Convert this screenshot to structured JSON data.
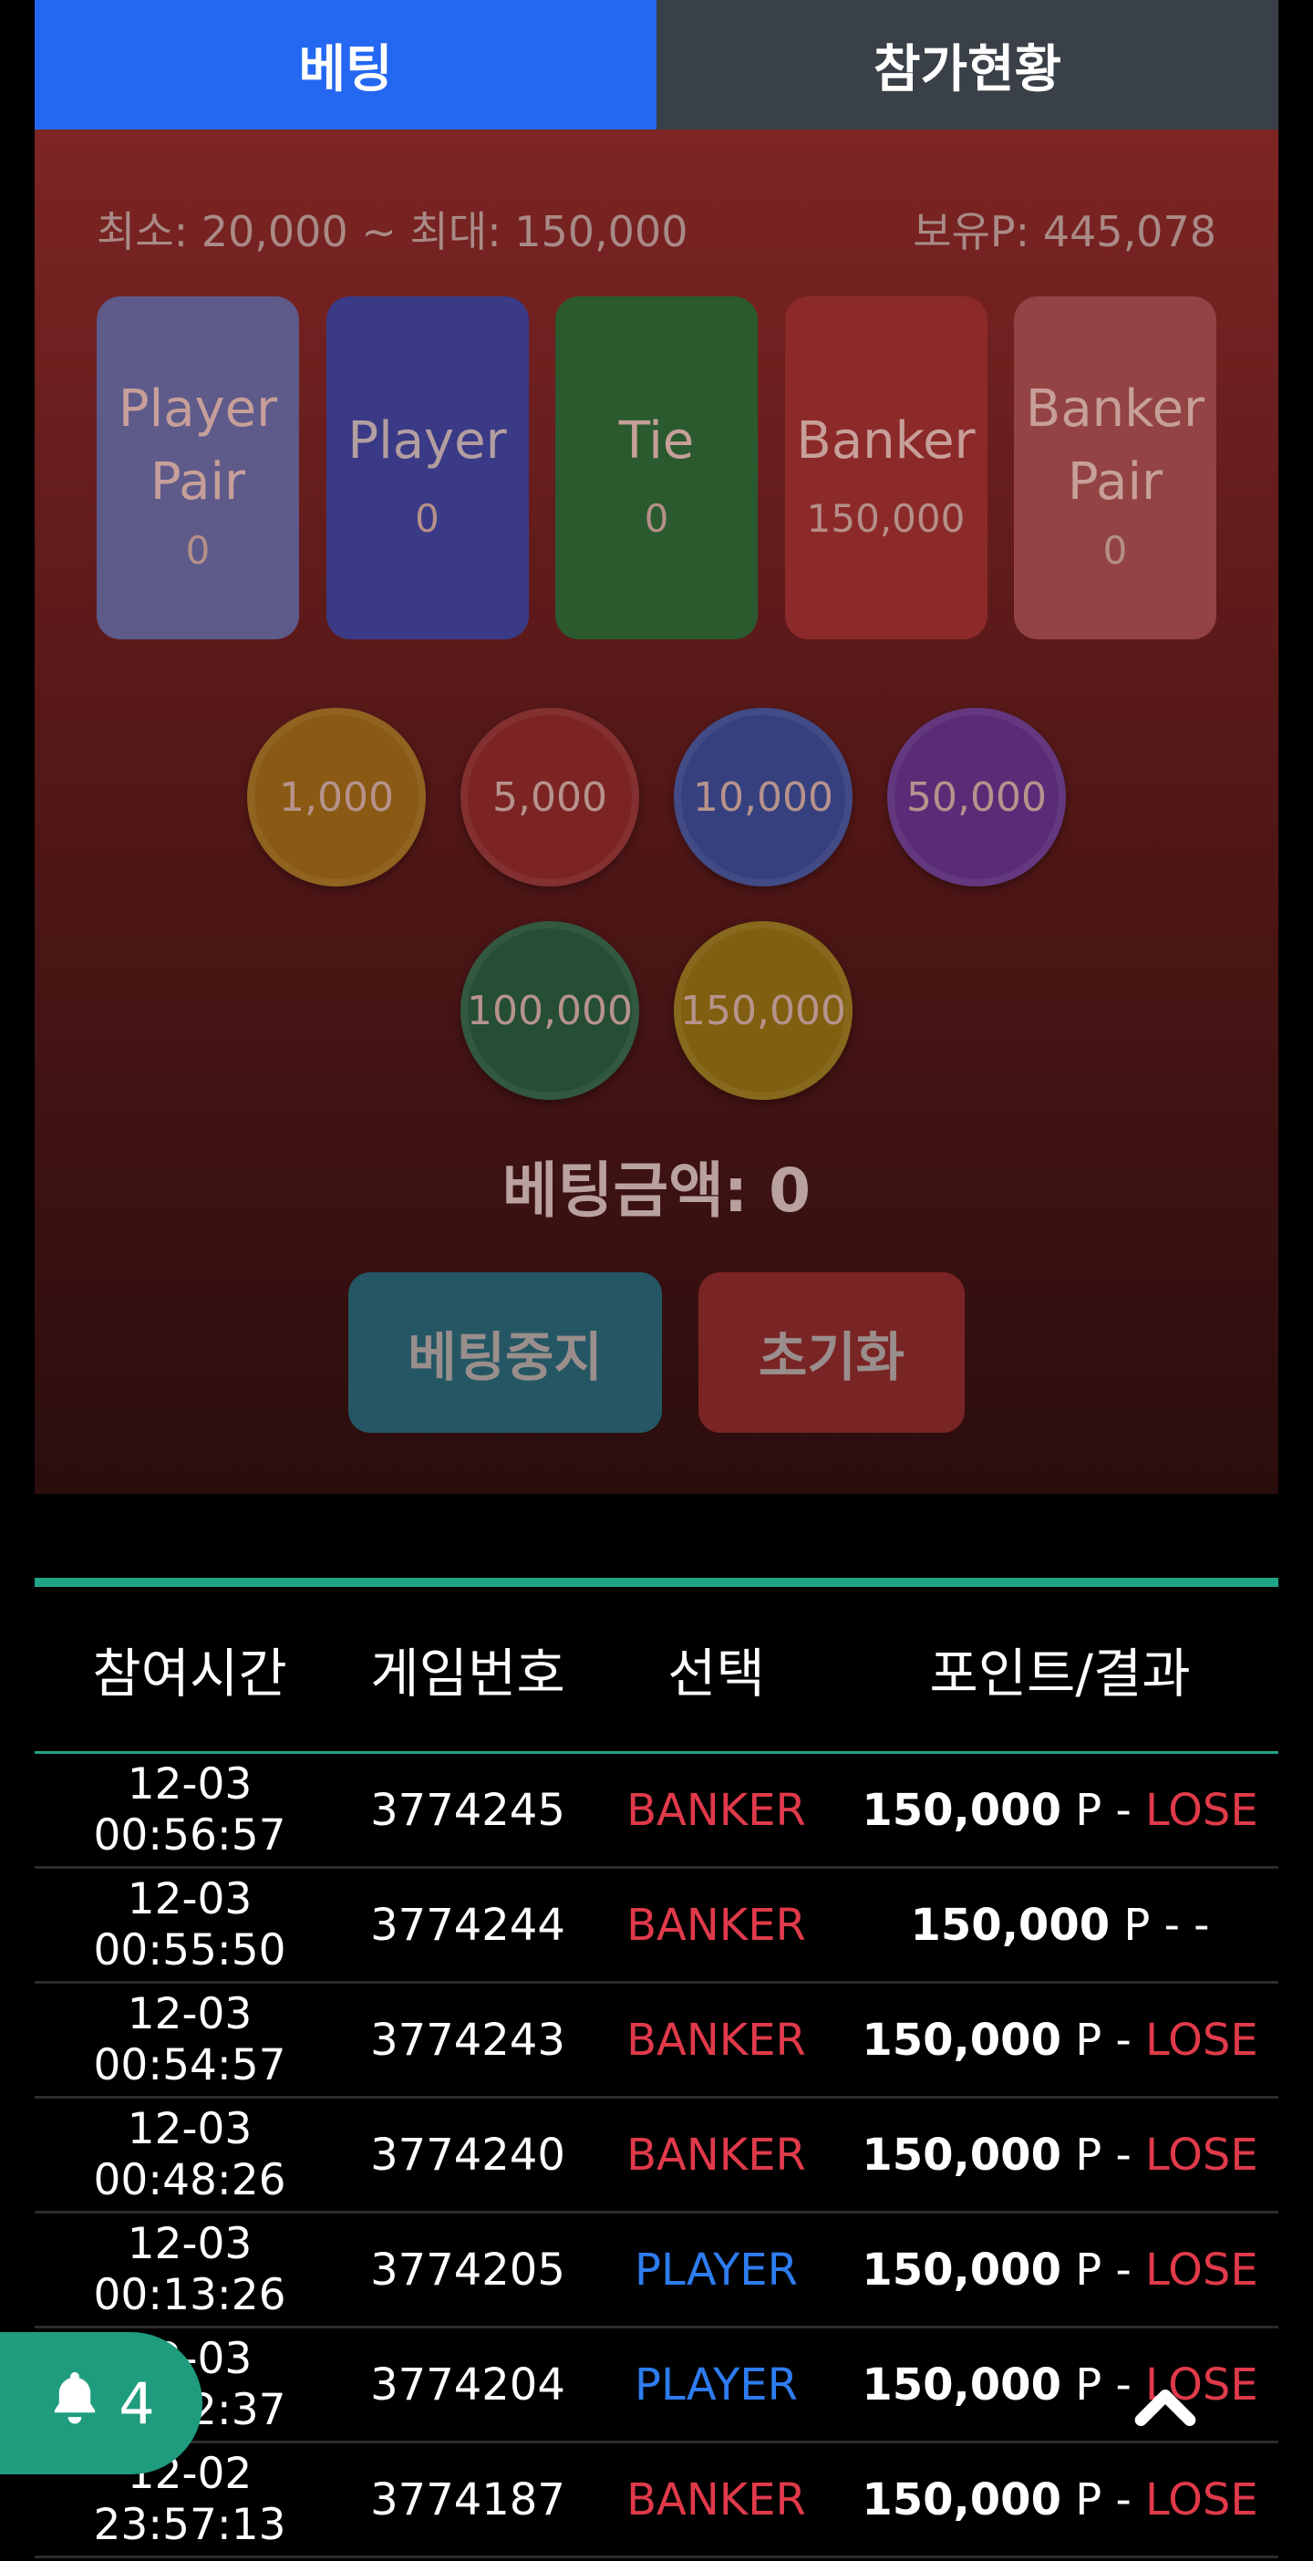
{
  "tabs": {
    "betting": "베팅",
    "participation": "참가현황"
  },
  "limits": {
    "range": "최소: 20,000 ~ 최대: 150,000",
    "balance": "보유P: 445,078"
  },
  "bet_options": [
    {
      "name_line1": "Player",
      "name_line2": "Pair",
      "amount": "0"
    },
    {
      "name_line1": "Player",
      "name_line2": "",
      "amount": "0"
    },
    {
      "name_line1": "Tie",
      "name_line2": "",
      "amount": "0"
    },
    {
      "name_line1": "Banker",
      "name_line2": "",
      "amount": "150,000"
    },
    {
      "name_line1": "Banker",
      "name_line2": "Pair",
      "amount": "0"
    }
  ],
  "chips": [
    "1,000",
    "5,000",
    "10,000",
    "50,000",
    "100,000",
    "150,000"
  ],
  "bet_total": "베팅금액: 0",
  "actions": {
    "stop": "베팅중지",
    "reset": "초기화"
  },
  "history": {
    "headers": [
      "참여시간",
      "게임번호",
      "선택",
      "포인트/결과"
    ],
    "rows": [
      {
        "date": "12-03",
        "time": "00:56:57",
        "game": "3774245",
        "pick": "BANKER",
        "points": "150,000",
        "unit": "P -",
        "result": "LOSE"
      },
      {
        "date": "12-03",
        "time": "00:55:50",
        "game": "3774244",
        "pick": "BANKER",
        "points": "150,000",
        "unit": "P - -",
        "result": ""
      },
      {
        "date": "12-03",
        "time": "00:54:57",
        "game": "3774243",
        "pick": "BANKER",
        "points": "150,000",
        "unit": "P -",
        "result": "LOSE"
      },
      {
        "date": "12-03",
        "time": "00:48:26",
        "game": "3774240",
        "pick": "BANKER",
        "points": "150,000",
        "unit": "P -",
        "result": "LOSE"
      },
      {
        "date": "12-03",
        "time": "00:13:26",
        "game": "3774205",
        "pick": "PLAYER",
        "points": "150,000",
        "unit": "P -",
        "result": "LOSE"
      },
      {
        "date": "12-03",
        "time": "00:02:37",
        "game": "3774204",
        "pick": "PLAYER",
        "points": "150,000",
        "unit": "P -",
        "result": "LOSE"
      },
      {
        "date": "12-02",
        "time": "23:57:13",
        "game": "3774187",
        "pick": "BANKER",
        "points": "150,000",
        "unit": "P -",
        "result": "LOSE"
      }
    ]
  },
  "notification": {
    "count": "4"
  },
  "icons": {
    "bell": "bell-icon",
    "scroll_top": "chevron-up-icon"
  },
  "colors": {
    "tab_active": "#2468f2",
    "accent_green": "#20a486",
    "banker": "#e03a4a",
    "player": "#2e7cf0"
  }
}
